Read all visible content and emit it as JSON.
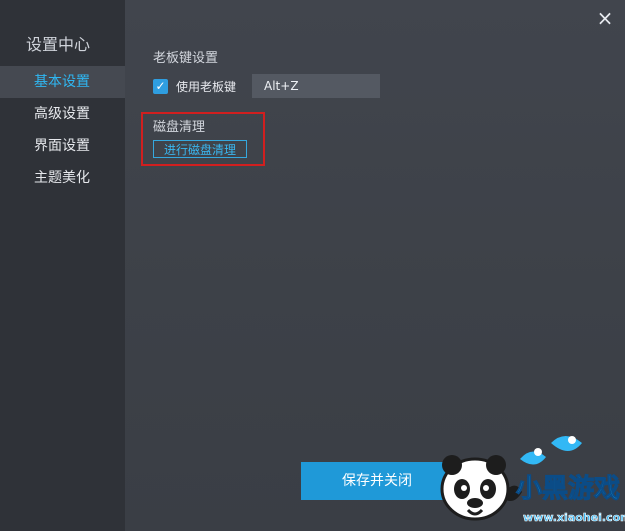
{
  "sidebar": {
    "title": "设置中心",
    "items": [
      {
        "label": "基本设置",
        "active": true
      },
      {
        "label": "高级设置",
        "active": false
      },
      {
        "label": "界面设置",
        "active": false
      },
      {
        "label": "主题美化",
        "active": false
      }
    ]
  },
  "window": {
    "close_icon": "×"
  },
  "hotkey": {
    "section_title": "老板键设置",
    "checkbox_label": "使用老板键",
    "checked": true,
    "value": "Alt+Z"
  },
  "disk": {
    "section_title": "磁盘清理",
    "button_label": "进行磁盘清理"
  },
  "footer": {
    "save_label": "保存并关闭"
  },
  "watermark": {
    "brand_text": "小黑游戏",
    "url": "www.xiaohei.com"
  },
  "colors": {
    "accent": "#2fb7f2",
    "button": "#1f99d8",
    "highlight_box": "#d11f1f",
    "sidebar": "#2f3238",
    "panel": "#3d4148"
  }
}
